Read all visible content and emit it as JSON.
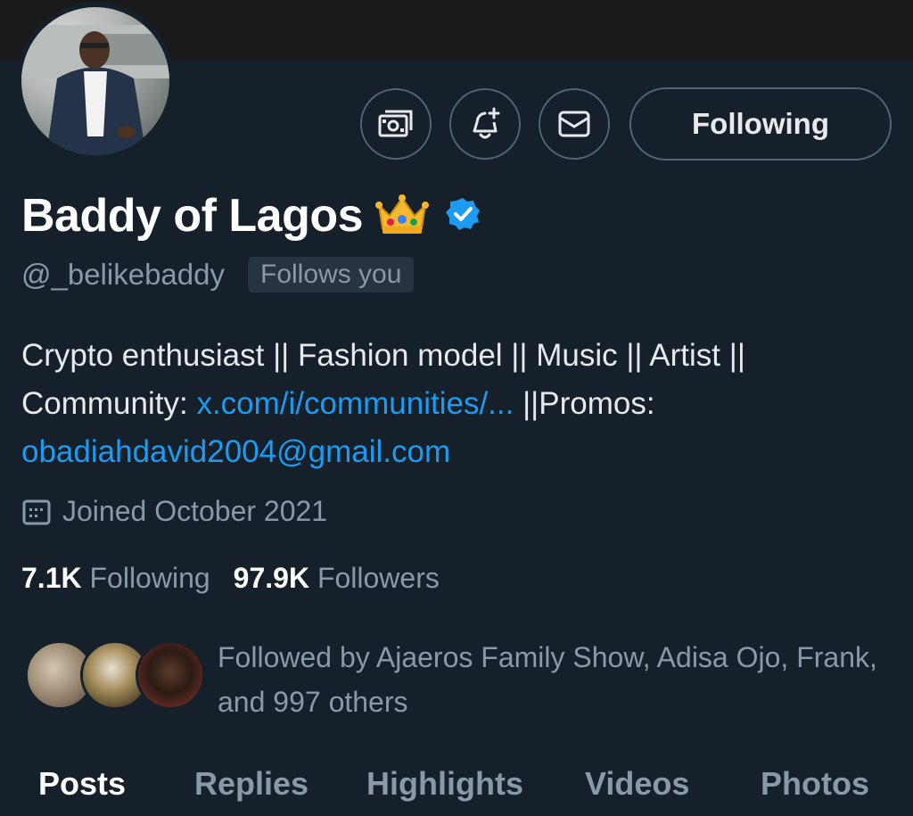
{
  "profile": {
    "display_name": "Baddy of Lagos",
    "handle": "@_belikebaddy",
    "follows_you_badge": "Follows you",
    "bio": {
      "line1": "Crypto enthusiast || Fashion model || Music || Artist ||",
      "line2_prefix": "Community: ",
      "community_link": "x.com/i/communities/...",
      "line2_suffix": " ||Promos:",
      "email_link": "obadiahdavid2004@gmail.com"
    },
    "joined": "Joined October 2021",
    "following_count": "7.1K",
    "following_label": "Following",
    "followers_count": "97.9K",
    "followers_label": "Followers",
    "followed_by": "Followed by Ajaeros Family Show, Adisa Ojo, Frank, and 997 others"
  },
  "actions": {
    "follow_button_label": "Following",
    "icons": [
      "money-icon",
      "notification-bell-icon",
      "message-icon"
    ]
  },
  "tabs": [
    "Posts",
    "Replies",
    "Highlights",
    "Videos",
    "Photos"
  ],
  "colors": {
    "background": "#15202b",
    "link": "#1d9bf0",
    "muted": "#8b98a5",
    "verified": "#1d9bf0"
  }
}
